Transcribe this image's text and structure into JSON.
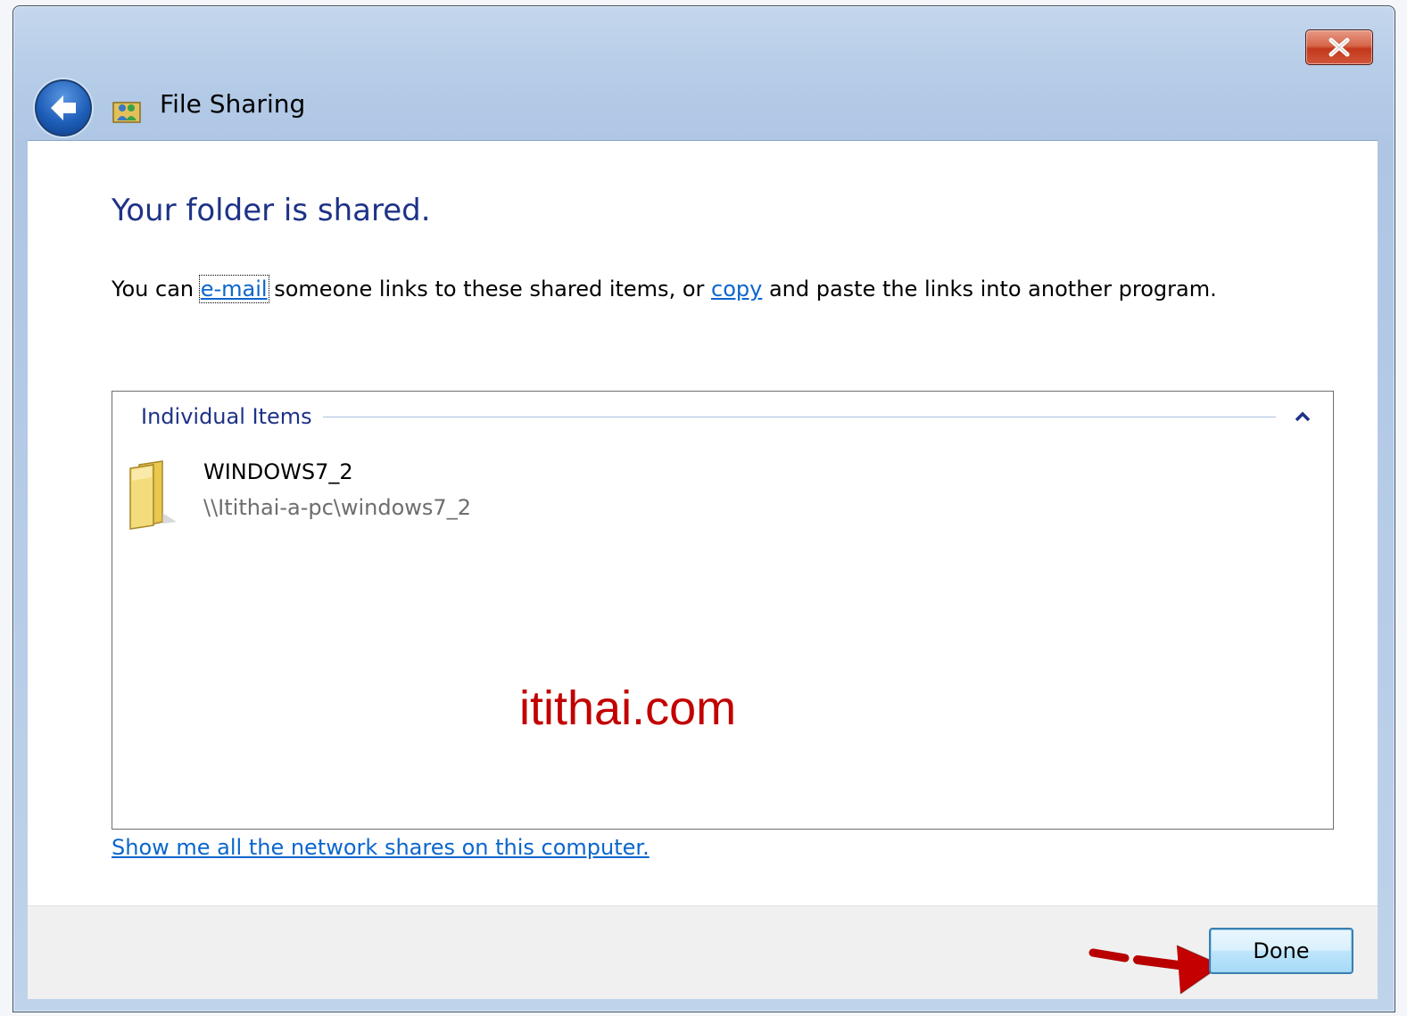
{
  "window": {
    "title": "File Sharing",
    "close_icon": "close-icon",
    "back_icon": "back-arrow-icon",
    "app_icon": "people-sharing-icon"
  },
  "main": {
    "heading": "Your folder is shared.",
    "instruction": {
      "prefix": "You can ",
      "email_link": "e-mail",
      "middle": " someone links to these shared items, or ",
      "copy_link": "copy",
      "suffix": " and paste the links into another program."
    }
  },
  "items_group": {
    "title": "Individual Items",
    "collapse_icon": "chevron-up-icon",
    "items": [
      {
        "name": "WINDOWS7_2",
        "path": "\\\\Itithai-a-pc\\windows7_2",
        "icon": "folder-icon"
      }
    ]
  },
  "watermark": "itithai.com",
  "network_shares_link": "Show me all the network shares on this computer.",
  "footer": {
    "done_label": "Done",
    "annotation_icon": "red-arrow-icon"
  },
  "colors": {
    "heading": "#1e3287",
    "link": "#0b66cc",
    "watermark": "#c20000",
    "annotation_arrow": "#c40000"
  }
}
